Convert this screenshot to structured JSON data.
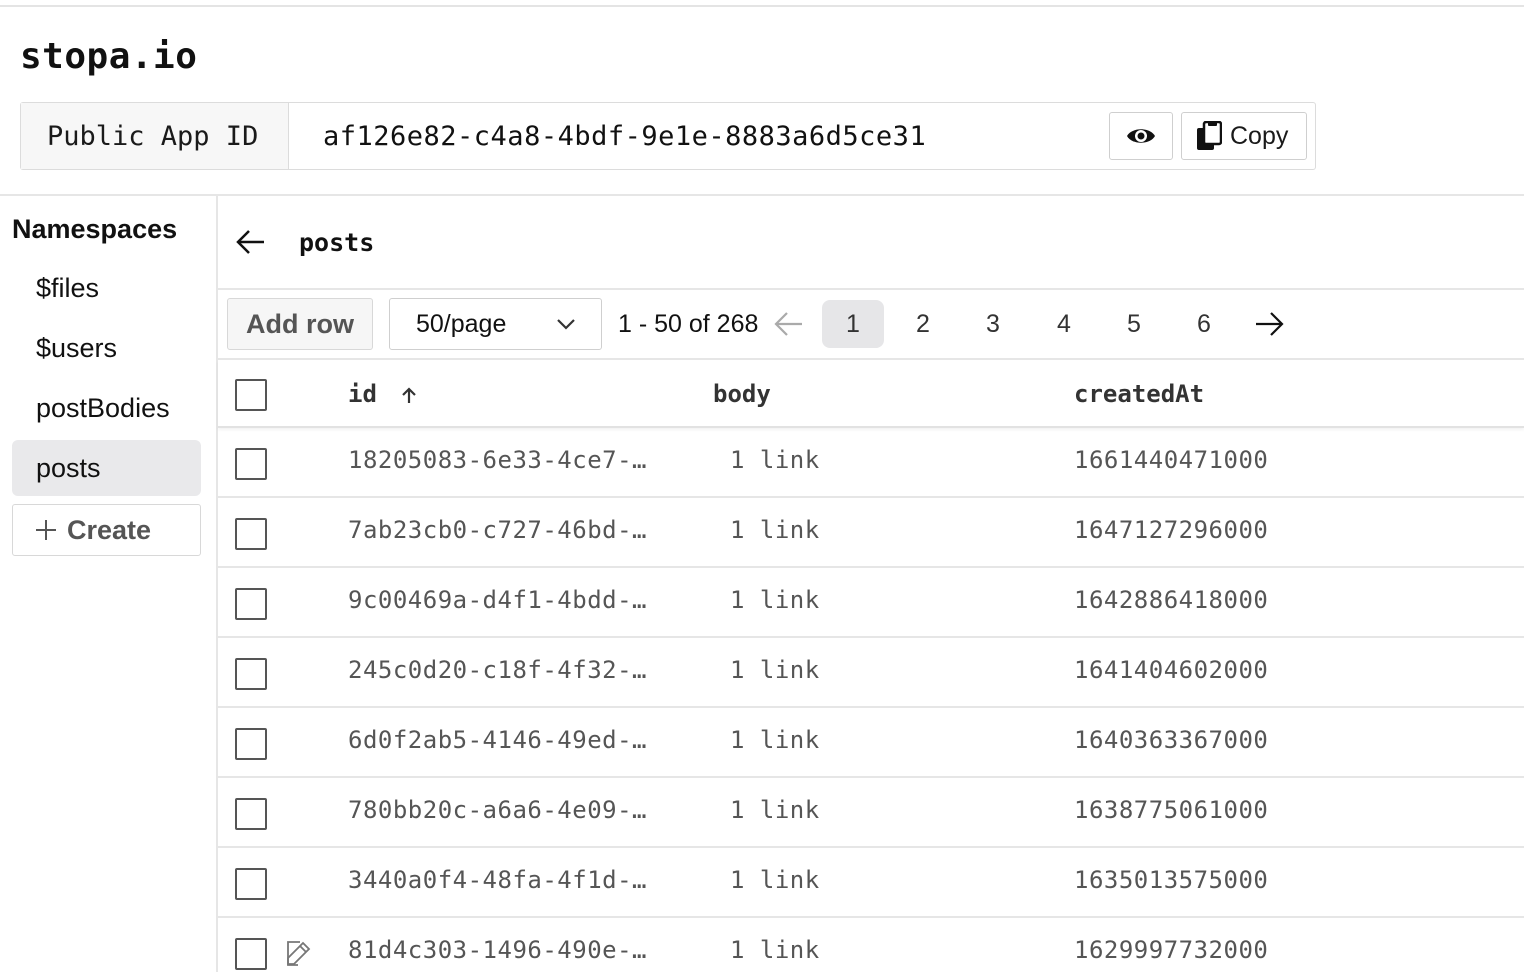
{
  "app": {
    "title": "stopa.io",
    "app_id_label": "Public App ID",
    "app_id_value": "af126e82-c4a8-4bdf-9e1e-8883a6d5ce31",
    "copy_label": "Copy"
  },
  "sidebar": {
    "title": "Namespaces",
    "items": [
      {
        "label": "$files",
        "active": false
      },
      {
        "label": "$users",
        "active": false
      },
      {
        "label": "postBodies",
        "active": false
      },
      {
        "label": "posts",
        "active": true
      }
    ],
    "create_label": "Create"
  },
  "main": {
    "namespace": "posts",
    "add_row_label": "Add row",
    "page_size": "50/page",
    "range_text": "1 - 50 of 268",
    "pages": [
      "1",
      "2",
      "3",
      "4",
      "5",
      "6"
    ],
    "current_page": "1",
    "columns": [
      "id",
      "body",
      "createdAt"
    ],
    "sort_column": "id",
    "sort_direction": "ascending",
    "rows": [
      {
        "id": "18205083-6e33-4ce7-…",
        "body": "1 link",
        "createdAt": "1661440471000"
      },
      {
        "id": "7ab23cb0-c727-46bd-…",
        "body": "1 link",
        "createdAt": "1647127296000"
      },
      {
        "id": "9c00469a-d4f1-4bdd-…",
        "body": "1 link",
        "createdAt": "1642886418000"
      },
      {
        "id": "245c0d20-c18f-4f32-…",
        "body": "1 link",
        "createdAt": "1641404602000"
      },
      {
        "id": "6d0f2ab5-4146-49ed-…",
        "body": "1 link",
        "createdAt": "1640363367000"
      },
      {
        "id": "780bb20c-a6a6-4e09-…",
        "body": "1 link",
        "createdAt": "1638775061000"
      },
      {
        "id": "3440a0f4-48fa-4f1d-…",
        "body": "1 link",
        "createdAt": "1635013575000"
      },
      {
        "id": "81d4c303-1496-490e-…",
        "body": "1 link",
        "createdAt": "1629997732000"
      }
    ]
  }
}
